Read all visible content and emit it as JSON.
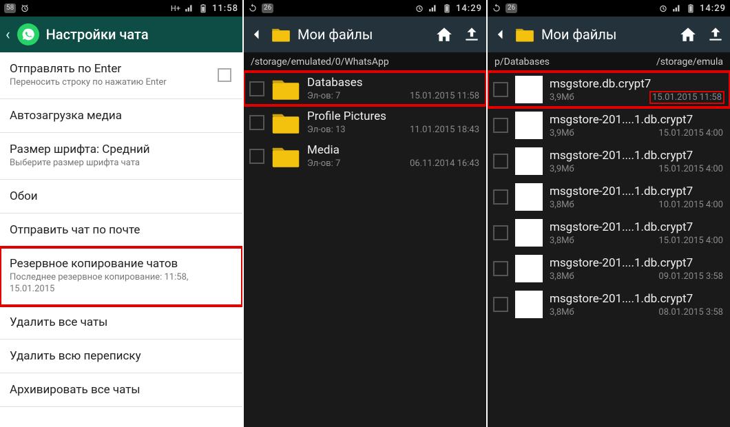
{
  "screen1": {
    "status": {
      "badge": "58",
      "net": "H+",
      "time": "11:58"
    },
    "header": {
      "title": "Настройки чата"
    },
    "items": [
      {
        "title": "Отправлять по Enter",
        "sub": "Переносить строку по нажатию Enter",
        "checkbox": true
      },
      {
        "title": "Автозагрузка медиа"
      },
      {
        "title": "Размер шрифта: Средний",
        "sub": "Выберите размер шрифта чата"
      },
      {
        "title": "Обои"
      },
      {
        "title": "Отправить чат по почте"
      },
      {
        "title": "Резервное копирование чатов",
        "sub": "Последнее резервное копирование: 11:58, 15.01.2015",
        "highlight": true
      },
      {
        "title": "Удалить все чаты"
      },
      {
        "title": "Удалить всю переписку"
      },
      {
        "title": "Архивировать все чаты"
      }
    ]
  },
  "screen2": {
    "status": {
      "badge": "26",
      "time": "14:29"
    },
    "header": {
      "title": "Мои файлы"
    },
    "breadcrumb": "/storage/emulated/0/WhatsApp",
    "rows": [
      {
        "name": "Databases",
        "sub": "Эл-ов: 7",
        "date": "15.01.2015 11:58",
        "icon": "folder",
        "highlight": true
      },
      {
        "name": "Profile Pictures",
        "sub": "Эл-ов: 13",
        "date": "11.01.2015 18:43",
        "icon": "folder"
      },
      {
        "name": "Media",
        "sub": "Эл-ов: 7",
        "date": "06.11.2014 16:43",
        "icon": "folder"
      }
    ]
  },
  "screen3": {
    "status": {
      "badge": "26",
      "time": "14:29"
    },
    "header": {
      "title": "Мои файлы"
    },
    "breadcrumb_left": "p/Databases",
    "breadcrumb_right": "/storage/emula",
    "rows": [
      {
        "name": "msgstore.db.crypt7",
        "sub": "3,9Мб",
        "date": "15.01.2015 11:58",
        "icon": "file",
        "row_hl": true,
        "date_hl": true
      },
      {
        "name": "msgstore-201....1.db.crypt7",
        "sub": "3,9Мб",
        "date": "15.01.2015 4:00",
        "icon": "file"
      },
      {
        "name": "msgstore-201....1.db.crypt7",
        "sub": "3,9Мб",
        "date": "15.01.2015 4:00",
        "icon": "file"
      },
      {
        "name": "msgstore-201....1.db.crypt7",
        "sub": "3,8Мб",
        "date": "10.01.2015 4:00",
        "icon": "file"
      },
      {
        "name": "msgstore-201....1.db.crypt7",
        "sub": "3,8Мб",
        "date": "15.01.2015 4:00",
        "icon": "file"
      },
      {
        "name": "msgstore-201....1.db.crypt7",
        "sub": "3,8Мб",
        "date": "09.01.2015 3:58",
        "icon": "file"
      },
      {
        "name": "msgstore-201....1.db.crypt7",
        "sub": "3,8Мб",
        "date": "08.01.2015 3:58",
        "icon": "file"
      }
    ]
  }
}
